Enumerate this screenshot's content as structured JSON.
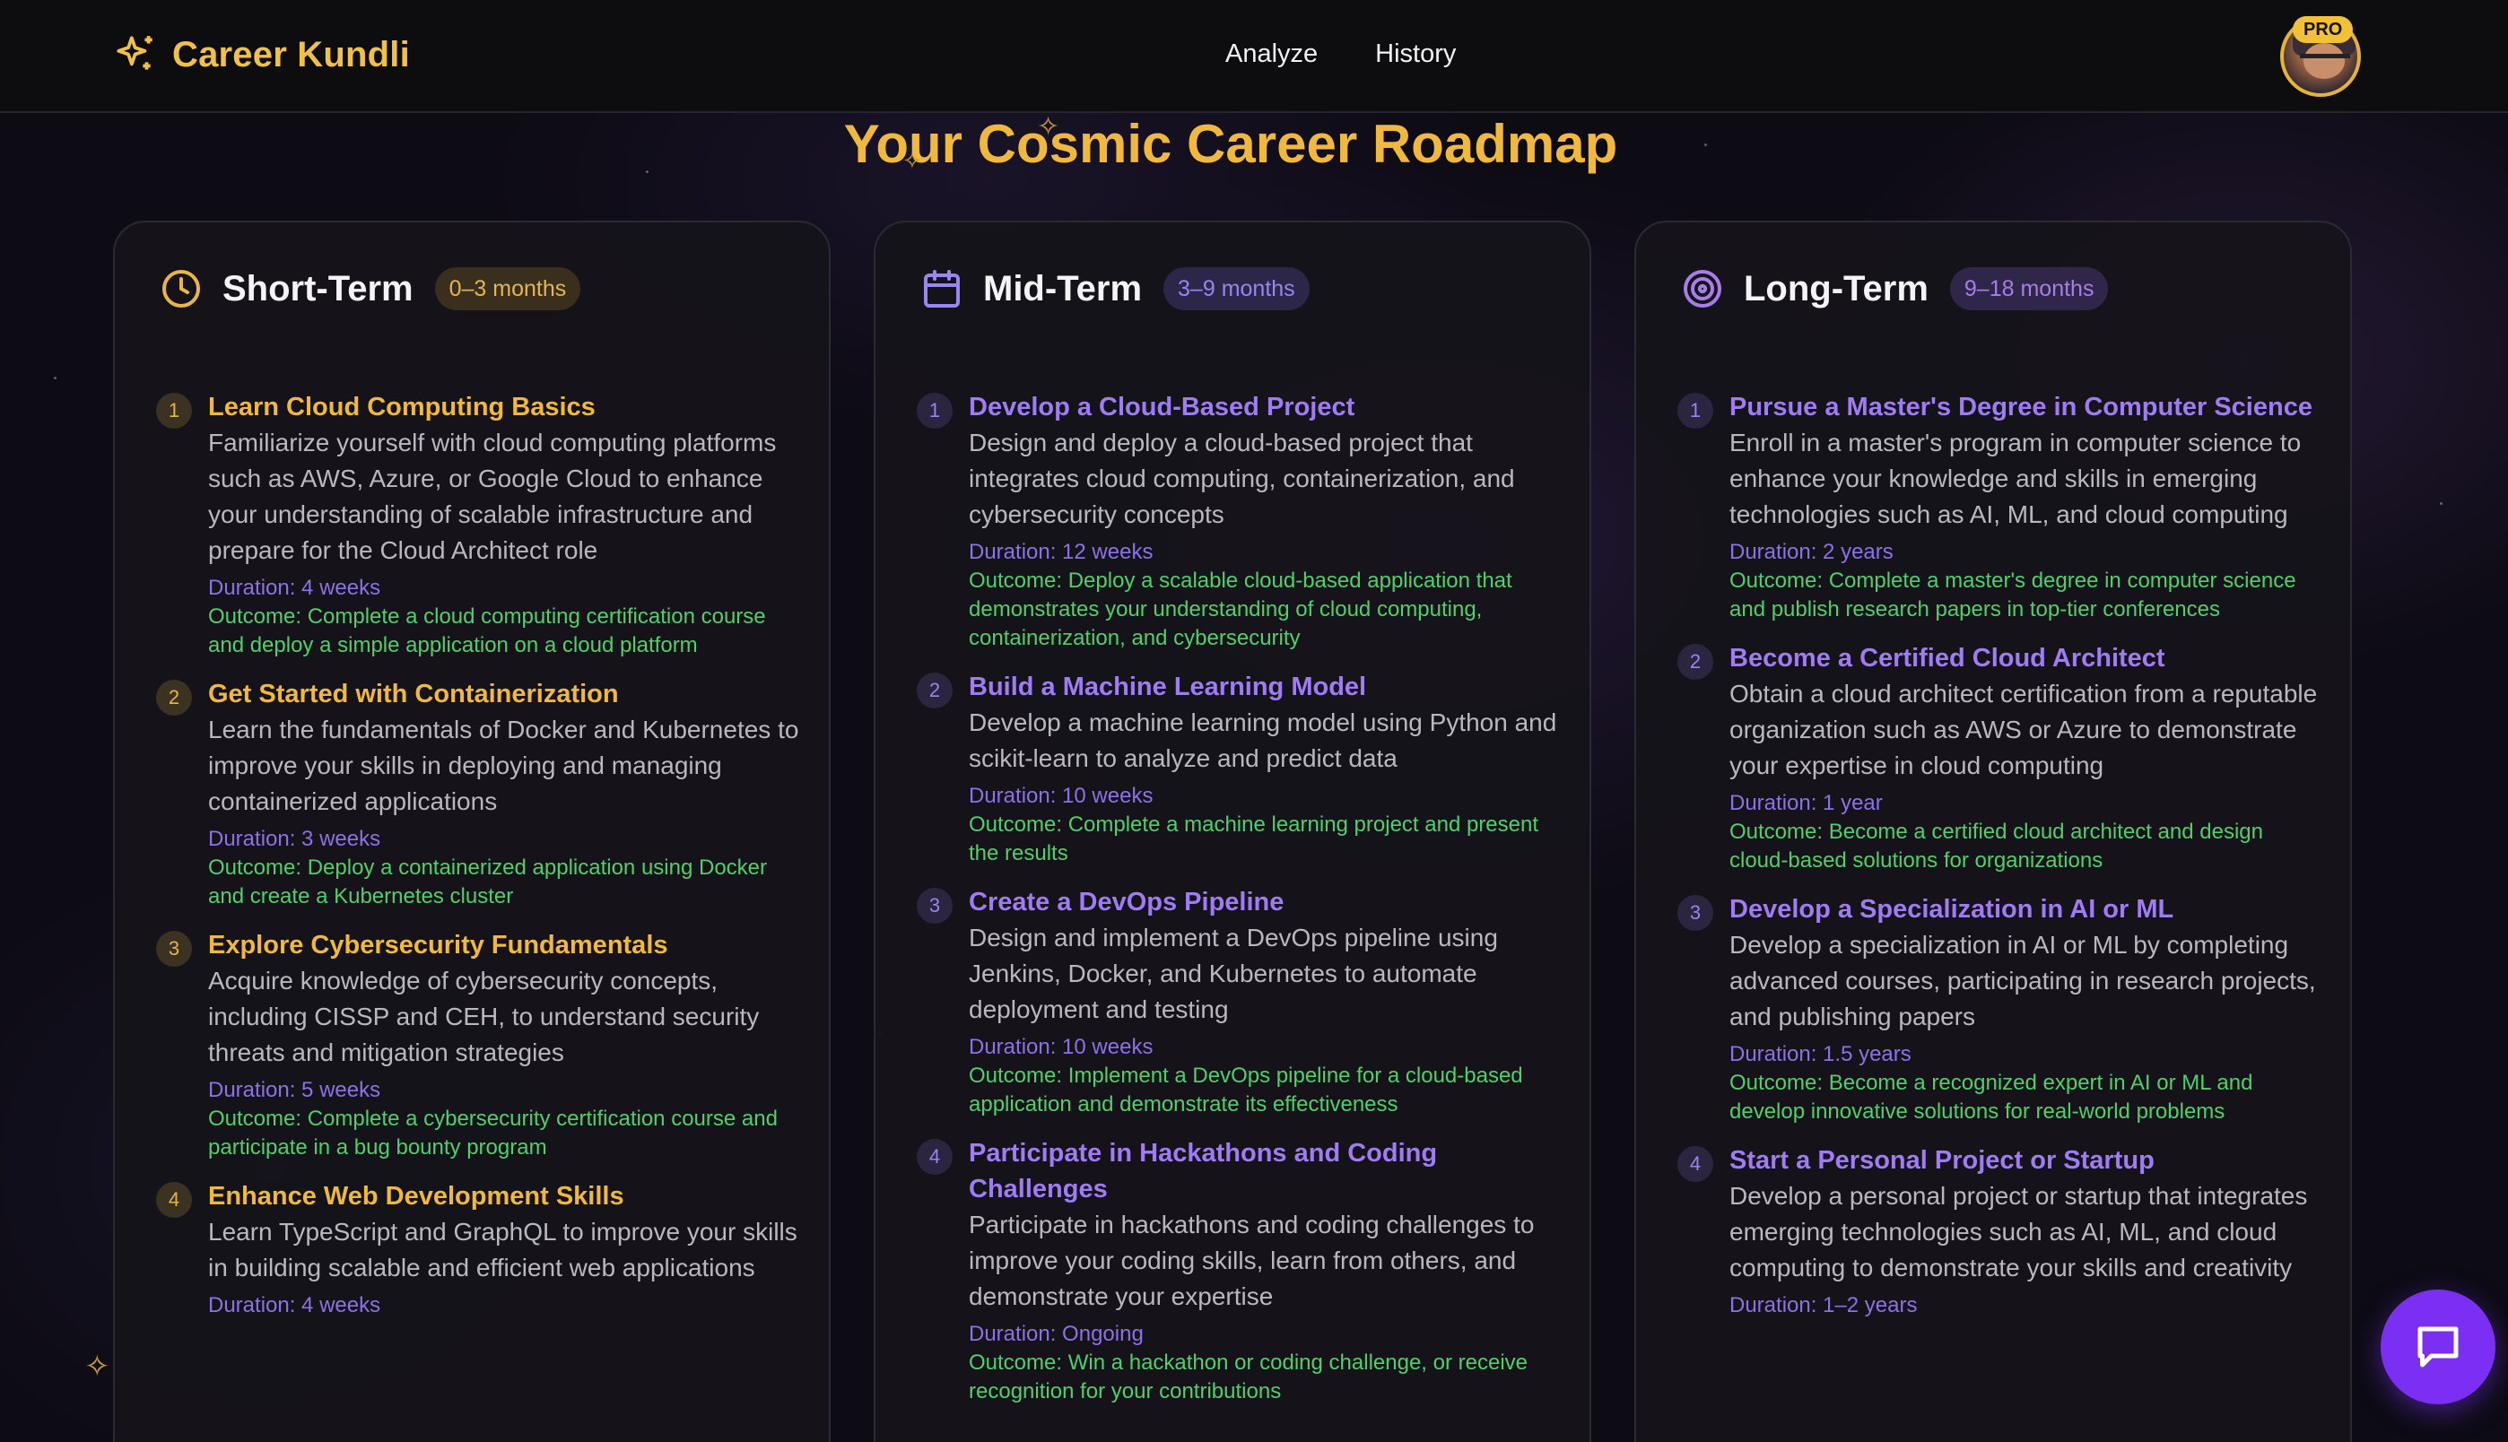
{
  "header": {
    "app_name": "Career Kundli",
    "nav": [
      "Analyze",
      "History"
    ],
    "badge": "PRO"
  },
  "page": {
    "title": "Your Cosmic Career Roadmap"
  },
  "columns": [
    {
      "title": "Short-Term",
      "range": "0–3 months",
      "icon": "clock-icon",
      "items": [
        {
          "num": "1",
          "title": "Learn Cloud Computing Basics",
          "desc": "Familiarize yourself with cloud computing platforms such as AWS, Azure, or Google Cloud to enhance your understanding of scalable infrastructure and prepare for the Cloud Architect role",
          "duration": "Duration: 4 weeks",
          "outcome": "Outcome: Complete a cloud computing certification course and deploy a simple application on a cloud platform"
        },
        {
          "num": "2",
          "title": "Get Started with Containerization",
          "desc": "Learn the fundamentals of Docker and Kubernetes to improve your skills in deploying and managing containerized applications",
          "duration": "Duration: 3 weeks",
          "outcome": "Outcome: Deploy a containerized application using Docker and create a Kubernetes cluster"
        },
        {
          "num": "3",
          "title": "Explore Cybersecurity Fundamentals",
          "desc": "Acquire knowledge of cybersecurity concepts, including CISSP and CEH, to understand security threats and mitigation strategies",
          "duration": "Duration: 5 weeks",
          "outcome": "Outcome: Complete a cybersecurity certification course and participate in a bug bounty program"
        },
        {
          "num": "4",
          "title": "Enhance Web Development Skills",
          "desc": "Learn TypeScript and GraphQL to improve your skills in building scalable and efficient web applications",
          "duration": "Duration: 4 weeks",
          "outcome": ""
        }
      ]
    },
    {
      "title": "Mid-Term",
      "range": "3–9 months",
      "icon": "calendar-icon",
      "items": [
        {
          "num": "1",
          "title": "Develop a Cloud-Based Project",
          "desc": "Design and deploy a cloud-based project that integrates cloud computing, containerization, and cybersecurity concepts",
          "duration": "Duration: 12 weeks",
          "outcome": "Outcome: Deploy a scalable cloud-based application that demonstrates your understanding of cloud computing, containerization, and cybersecurity"
        },
        {
          "num": "2",
          "title": "Build a Machine Learning Model",
          "desc": "Develop a machine learning model using Python and scikit-learn to analyze and predict data",
          "duration": "Duration: 10 weeks",
          "outcome": "Outcome: Complete a machine learning project and present the results"
        },
        {
          "num": "3",
          "title": "Create a DevOps Pipeline",
          "desc": "Design and implement a DevOps pipeline using Jenkins, Docker, and Kubernetes to automate deployment and testing",
          "duration": "Duration: 10 weeks",
          "outcome": "Outcome: Implement a DevOps pipeline for a cloud-based application and demonstrate its effectiveness"
        },
        {
          "num": "4",
          "title": "Participate in Hackathons and Coding Challenges",
          "desc": "Participate in hackathons and coding challenges to improve your coding skills, learn from others, and demonstrate your expertise",
          "duration": "Duration: Ongoing",
          "outcome": "Outcome: Win a hackathon or coding challenge, or receive recognition for your contributions"
        }
      ]
    },
    {
      "title": "Long-Term",
      "range": "9–18 months",
      "icon": "target-icon",
      "items": [
        {
          "num": "1",
          "title": "Pursue a Master's Degree in Computer Science",
          "desc": "Enroll in a master's program in computer science to enhance your knowledge and skills in emerging technologies such as AI, ML, and cloud computing",
          "duration": "Duration: 2 years",
          "outcome": "Outcome: Complete a master's degree in computer science and publish research papers in top-tier conferences"
        },
        {
          "num": "2",
          "title": "Become a Certified Cloud Architect",
          "desc": "Obtain a cloud architect certification from a reputable organization such as AWS or Azure to demonstrate your expertise in cloud computing",
          "duration": "Duration: 1 year",
          "outcome": "Outcome: Become a certified cloud architect and design cloud-based solutions for organizations"
        },
        {
          "num": "3",
          "title": "Develop a Specialization in AI or ML",
          "desc": "Develop a specialization in AI or ML by completing advanced courses, participating in research projects, and publishing papers",
          "duration": "Duration: 1.5 years",
          "outcome": "Outcome: Become a recognized expert in AI or ML and develop innovative solutions for real-world problems"
        },
        {
          "num": "4",
          "title": "Start a Personal Project or Startup",
          "desc": "Develop a personal project or startup that integrates emerging technologies such as AI, ML, and cloud computing to demonstrate your skills and creativity",
          "duration": "Duration: 1–2 years",
          "outcome": ""
        }
      ]
    }
  ],
  "colors": {
    "gold": "#f0b93e",
    "purple": "#9f7bf5",
    "green": "#4fd06b",
    "fab": "#7b2ff2"
  }
}
